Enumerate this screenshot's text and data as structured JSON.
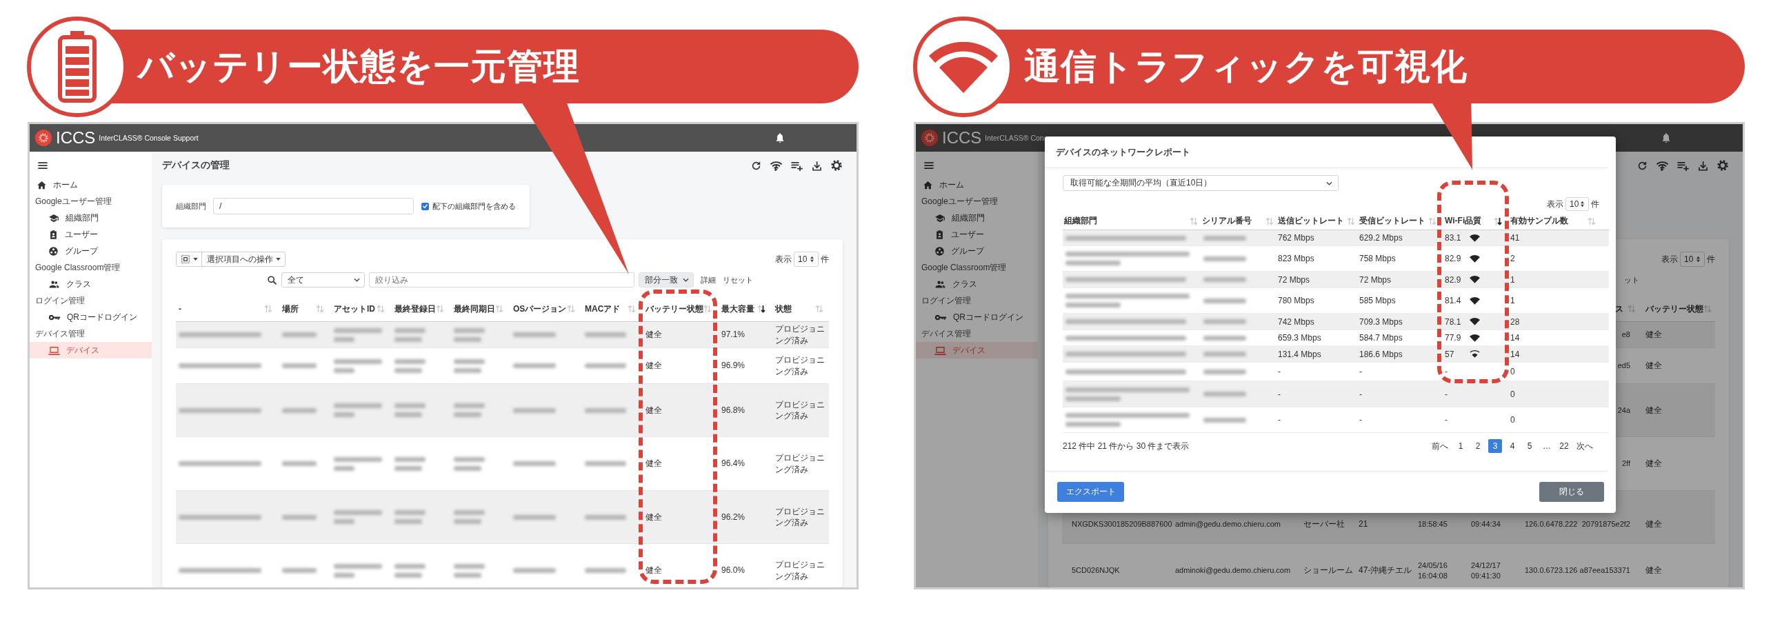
{
  "left": {
    "callout": {
      "title": "バッテリー状態を一元管理",
      "kind": "battery"
    },
    "app": {
      "logo": "ICCS",
      "product": "InterCLASS® Console Support",
      "sidebar": [
        {
          "items": [
            {
              "label": "ホーム",
              "selected": false
            }
          ]
        },
        {
          "heading": "Googleユーザー管理",
          "items": [
            {
              "label": "組織部門",
              "selected": false
            },
            {
              "label": "ユーザー",
              "selected": false
            },
            {
              "label": "グループ",
              "selected": false
            }
          ]
        },
        {
          "heading": "Google Classroom管理",
          "items": [
            {
              "label": "クラス",
              "selected": false
            }
          ]
        },
        {
          "heading": "ログイン管理",
          "items": [
            {
              "label": "QRコードログイン",
              "selected": false
            }
          ]
        },
        {
          "heading": "デバイス管理",
          "items": [
            {
              "label": "デバイス",
              "selected": true
            }
          ]
        }
      ],
      "page_title": "デバイスの管理",
      "org_filter": {
        "label": "組織部門",
        "value": "/",
        "include_children": {
          "label": "配下の組織部門を含める",
          "checked": true
        }
      },
      "toolbar": {
        "bulk_action": "選択項目への操作",
        "show_label": "表示",
        "page_size": "10",
        "unit": "件",
        "scope": "全て",
        "filter_placeholder": "絞り込み",
        "match": "部分一致",
        "detail": "詳細",
        "reset": "リセット"
      },
      "table": {
        "columns": [
          {
            "label": "-",
            "sorted": false
          },
          {
            "label": "場所",
            "sorted": false
          },
          {
            "label": "アセットID",
            "sorted": false
          },
          {
            "label": "最終登録日",
            "sorted": false
          },
          {
            "label": "最終同期日",
            "sorted": false
          },
          {
            "label": "OSバージョン",
            "sorted": false
          },
          {
            "label": "MACアド",
            "sorted": false
          },
          {
            "label": "バッテリー状態",
            "sorted": false
          },
          {
            "label": "最大容量",
            "sorted": true
          },
          {
            "label": "状態",
            "sorted": false
          }
        ],
        "rows": [
          {
            "cells": [
              null,
              null,
              null,
              null,
              null,
              null,
              null,
              "健全",
              "97.1%",
              "プロビジョニング済み"
            ]
          },
          {
            "cells": [
              null,
              null,
              null,
              null,
              null,
              null,
              null,
              "健全",
              "96.9%",
              "プロビジョニング済み"
            ]
          },
          {
            "cells": [
              null,
              null,
              null,
              null,
              null,
              null,
              null,
              "健全",
              "96.8%",
              "プロビジョニング済み"
            ]
          },
          {
            "cells": [
              null,
              null,
              null,
              null,
              null,
              null,
              null,
              "健全",
              "96.4%",
              "プロビジョニング済み"
            ]
          },
          {
            "cells": [
              null,
              null,
              null,
              null,
              null,
              null,
              null,
              "健全",
              "96.2%",
              "プロビジョニング済み"
            ]
          },
          {
            "cells": [
              null,
              null,
              null,
              null,
              null,
              null,
              null,
              "健全",
              "96.0%",
              "プロビジョニング済み"
            ]
          }
        ]
      }
    }
  },
  "right": {
    "callout": {
      "title": "通信トラフィックを可視化",
      "kind": "wifi"
    },
    "app": {
      "logo": "ICCS",
      "product": "InterCLASS® Cons",
      "sidebar": [
        {
          "items": [
            {
              "label": "ホーム",
              "selected": false
            }
          ]
        },
        {
          "heading": "Googleユーザー管理",
          "items": [
            {
              "label": "組織部門",
              "selected": false
            },
            {
              "label": "ユーザー",
              "selected": false
            },
            {
              "label": "グループ",
              "selected": false
            }
          ]
        },
        {
          "heading": "Google Classroom管理",
          "items": [
            {
              "label": "クラス",
              "selected": false
            }
          ]
        },
        {
          "heading": "ログイン管理",
          "items": [
            {
              "label": "QRコードログイン",
              "selected": false
            }
          ]
        },
        {
          "heading": "デバイス管理",
          "items": [
            {
              "label": "デバイス",
              "selected": true
            }
          ]
        }
      ],
      "toolbar": {
        "show_label": "表示",
        "page_size": "10",
        "unit": "件",
        "reset": "ット"
      },
      "table": {
        "columns": [
          {
            "label": "ス",
            "sorted": false
          },
          {
            "label": "バッテリー状態",
            "sorted": false
          }
        ],
        "rows": [
          {
            "cells": [
              "e8",
              "健全"
            ]
          },
          {
            "cells": [
              "ed5",
              "健全"
            ]
          },
          {
            "cells": [
              "24a",
              "健全"
            ]
          },
          {
            "cells": [
              "2ff",
              "健全"
            ]
          },
          {
            "cells": [
              "NXGDKS300185209B887600",
              "admin@gedu.demo.chieru.com",
              "セーバー社",
              "21",
              "18:58:45",
              "09:44:34",
              "126.0.6478.222",
              "20791875e2f2",
              "健全"
            ]
          },
          {
            "cells": [
              "5CD026NJQK",
              "adminoki@gedu.demo.chieru.com",
              "ショールーム",
              "47-沖縄チエル",
              "24/05/16\n16:04:08",
              "24/12/17\n09:41:30",
              "130.0.6723.126",
              "a87eea153371",
              "健全"
            ]
          }
        ]
      }
    },
    "modal": {
      "title": "デバイスのネットワークレポート",
      "period": "取得可能な全期間の平均（直近10日）",
      "show_label": "表示",
      "page_size": "10",
      "unit": "件",
      "columns": [
        {
          "label": "組織部門",
          "sorted": false
        },
        {
          "label": "シリアル番号",
          "sorted": false
        },
        {
          "label": "送信ビットレート",
          "sorted": false
        },
        {
          "label": "受信ビットレート",
          "sorted": false
        },
        {
          "label": "Wi-Fi品質",
          "sorted": true
        },
        {
          "label": "有効サンプル数",
          "sorted": false
        }
      ],
      "rows": [
        {
          "org": null,
          "serial": null,
          "tx": "762 Mbps",
          "rx": "629.2 Mbps",
          "wifi": "83.1",
          "kind": "strong",
          "samples": "41"
        },
        {
          "org": null,
          "serial": null,
          "tx": "823 Mbps",
          "rx": "758 Mbps",
          "wifi": "82.9",
          "kind": "strong",
          "samples": "2"
        },
        {
          "org": null,
          "serial": null,
          "tx": "72 Mbps",
          "rx": "72 Mbps",
          "wifi": "82.9",
          "kind": "strong",
          "samples": "1"
        },
        {
          "org": null,
          "serial": null,
          "tx": "780 Mbps",
          "rx": "585 Mbps",
          "wifi": "81.4",
          "kind": "strong",
          "samples": "1"
        },
        {
          "org": null,
          "serial": null,
          "tx": "742 Mbps",
          "rx": "709.3 Mbps",
          "wifi": "78.1",
          "kind": "strong",
          "samples": "28"
        },
        {
          "org": null,
          "serial": null,
          "tx": "659.3 Mbps",
          "rx": "584.7 Mbps",
          "wifi": "77.9",
          "kind": "strong",
          "samples": "14"
        },
        {
          "org": null,
          "serial": null,
          "tx": "131.4 Mbps",
          "rx": "186.6 Mbps",
          "wifi": "57",
          "kind": "weak",
          "samples": "14"
        },
        {
          "org": null,
          "serial": null,
          "tx": "-",
          "rx": "-",
          "wifi": "-",
          "kind": "none",
          "samples": "0"
        },
        {
          "org": null,
          "serial": null,
          "tx": "-",
          "rx": "-",
          "wifi": "-",
          "kind": "none",
          "samples": "0"
        },
        {
          "org": null,
          "serial": null,
          "tx": "-",
          "rx": "-",
          "wifi": "-",
          "kind": "none",
          "samples": "0"
        }
      ],
      "summary": "212 件中 21 件から 30 件まで表示",
      "pagination": [
        {
          "label": "前へ",
          "selected": false
        },
        {
          "label": "1",
          "selected": false
        },
        {
          "label": "2",
          "selected": false
        },
        {
          "label": "3",
          "selected": true
        },
        {
          "label": "4",
          "selected": false
        },
        {
          "label": "5",
          "selected": false
        },
        {
          "label": "…",
          "selected": false
        },
        {
          "label": "22",
          "selected": false
        },
        {
          "label": "次へ",
          "selected": false
        }
      ],
      "export": "エクスポート",
      "close": "閉じる"
    }
  }
}
